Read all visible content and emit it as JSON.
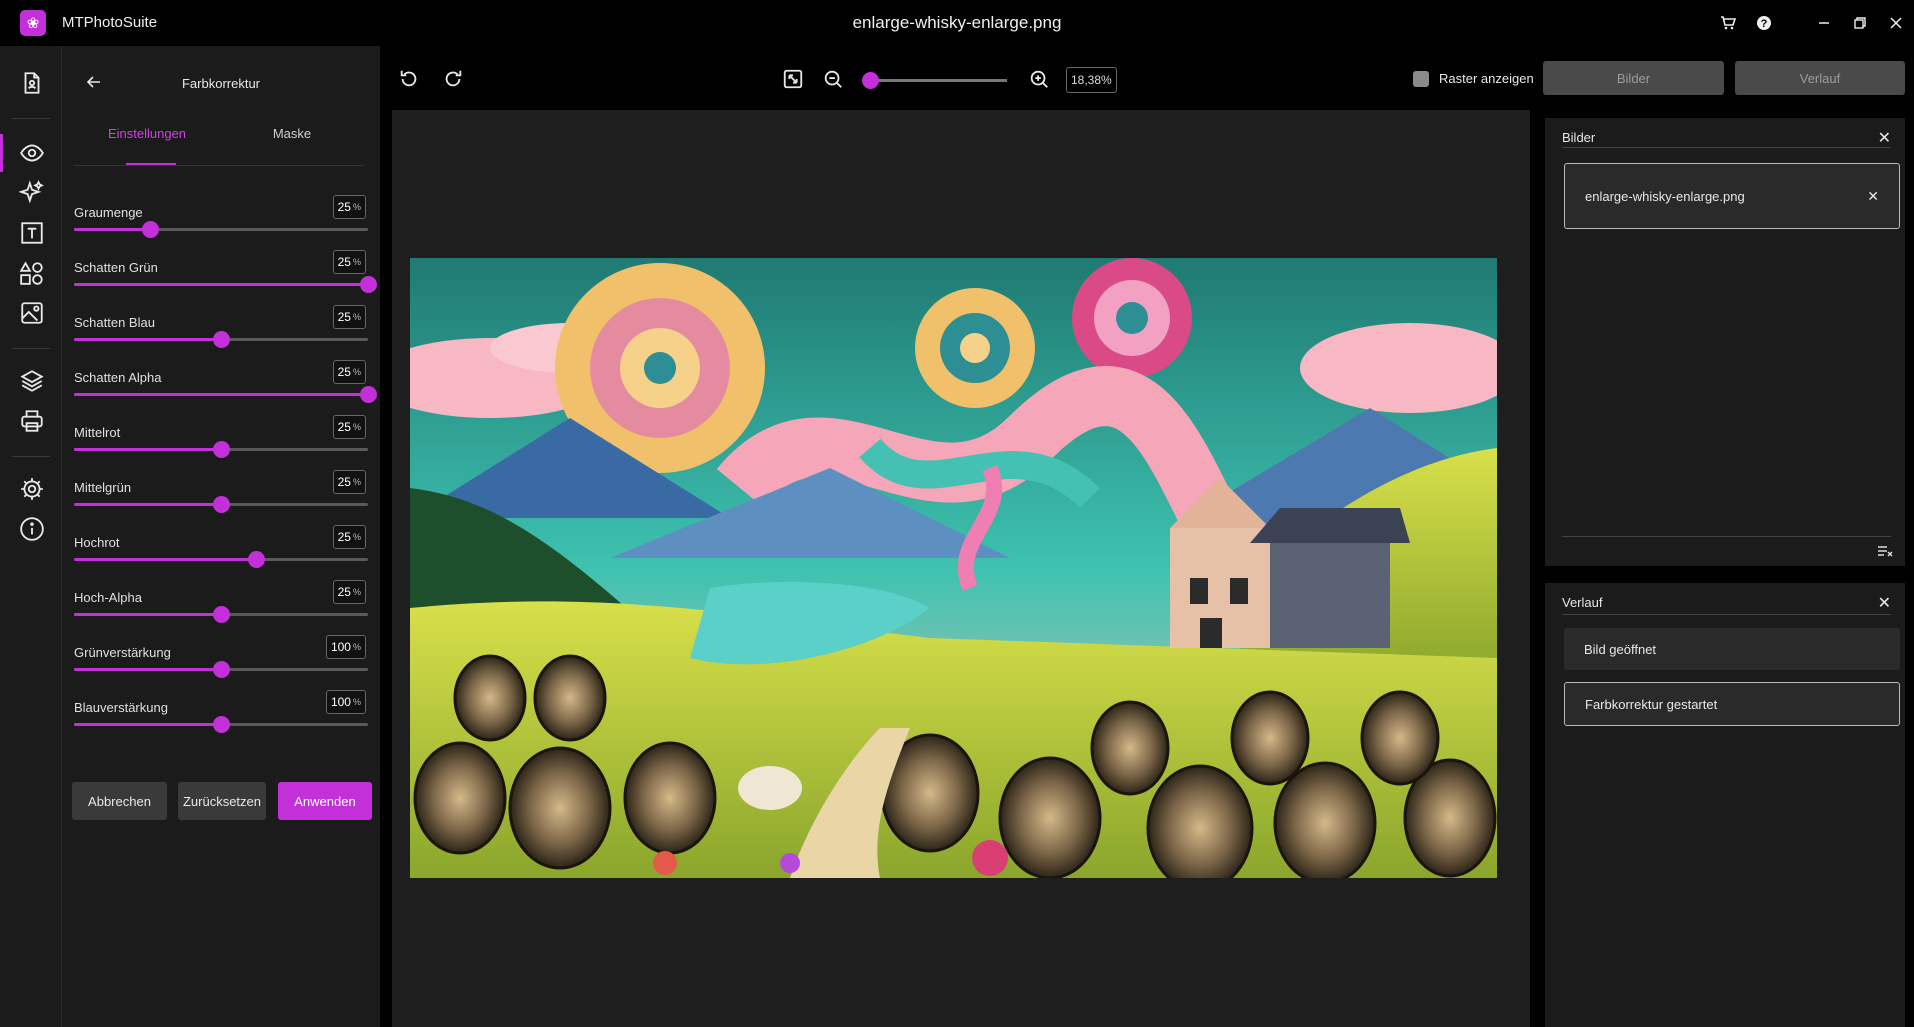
{
  "app": {
    "name": "MTPhotoSuite",
    "file_title": "enlarge-whisky-enlarge.png"
  },
  "panel": {
    "title": "Farbkorrektur",
    "tabs": [
      {
        "label": "Einstellungen",
        "active": true
      },
      {
        "label": "Maske",
        "active": false
      }
    ],
    "sliders": [
      {
        "label": "Graumenge",
        "value": "25",
        "unit": "%",
        "position": 0.26
      },
      {
        "label": "Schatten Grün",
        "value": "25",
        "unit": "%",
        "position": 1.0
      },
      {
        "label": "Schatten Blau",
        "value": "25",
        "unit": "%",
        "position": 0.5
      },
      {
        "label": "Schatten Alpha",
        "value": "25",
        "unit": "%",
        "position": 1.0
      },
      {
        "label": "Mittelrot",
        "value": "25",
        "unit": "%",
        "position": 0.5
      },
      {
        "label": "Mittelgrün",
        "value": "25",
        "unit": "%",
        "position": 0.5
      },
      {
        "label": "Hochrot",
        "value": "25",
        "unit": "%",
        "position": 0.62
      },
      {
        "label": "Hoch-Alpha",
        "value": "25",
        "unit": "%",
        "position": 0.5
      },
      {
        "label": "Grünverstärkung",
        "value": "100",
        "unit": "%",
        "position": 0.5
      },
      {
        "label": "Blauverstärkung",
        "value": "100",
        "unit": "%",
        "position": 0.5
      }
    ],
    "buttons": {
      "cancel": "Abbrechen",
      "reset": "Zurücksetzen",
      "apply": "Anwenden"
    }
  },
  "toolbar": {
    "zoom_value": "18,38%",
    "zoom_position": 0.0,
    "grid_label": "Raster anzeigen",
    "grid_checked": false,
    "images_button": "Bilder",
    "history_button": "Verlauf"
  },
  "images_panel": {
    "title": "Bilder",
    "items": [
      "enlarge-whisky-enlarge.png"
    ]
  },
  "history_panel": {
    "title": "Verlauf",
    "items": [
      "Bild geöffnet",
      "Farbkorrektur gestartet"
    ]
  },
  "icons": [
    "app-logo-icon",
    "document-icon",
    "eye-icon",
    "sparkle-icon",
    "text-icon",
    "shapes-icon",
    "image-icon",
    "layers-icon",
    "printer-icon",
    "gear-icon",
    "info-icon",
    "cart-icon",
    "help-icon",
    "minimize-icon",
    "restore-icon",
    "close-icon",
    "undo-icon",
    "redo-icon",
    "fit-screen-icon",
    "zoom-out-icon",
    "zoom-in-icon",
    "clear-list-icon"
  ],
  "colors": {
    "accent": "#c32fd9",
    "panel": "#1b1b1b",
    "canvas": "#1e1e1e"
  }
}
